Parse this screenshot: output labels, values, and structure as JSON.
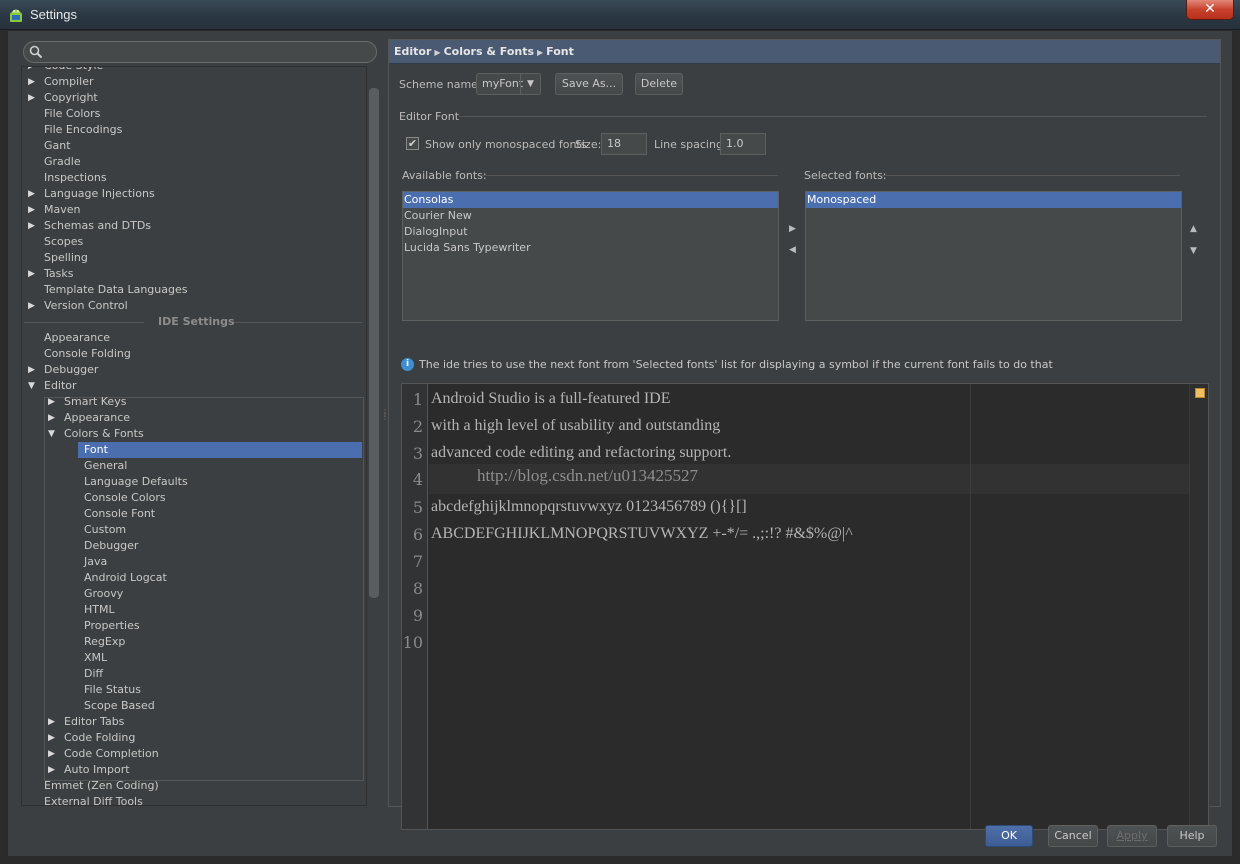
{
  "window": {
    "title": "Settings",
    "close_glyph": "✕"
  },
  "search": {
    "placeholder": "",
    "icon": "search-icon"
  },
  "tree": {
    "project_items": [
      {
        "label": "Code Style",
        "arrow": true
      },
      {
        "label": "Compiler",
        "arrow": true
      },
      {
        "label": "Copyright",
        "arrow": true
      },
      {
        "label": "File Colors",
        "arrow": false
      },
      {
        "label": "File Encodings",
        "arrow": false
      },
      {
        "label": "Gant",
        "arrow": false
      },
      {
        "label": "Gradle",
        "arrow": false
      },
      {
        "label": "Inspections",
        "arrow": false
      },
      {
        "label": "Language Injections",
        "arrow": true
      },
      {
        "label": "Maven",
        "arrow": true
      },
      {
        "label": "Schemas and DTDs",
        "arrow": true
      },
      {
        "label": "Scopes",
        "arrow": false
      },
      {
        "label": "Spelling",
        "arrow": false
      },
      {
        "label": "Tasks",
        "arrow": true
      },
      {
        "label": "Template Data Languages",
        "arrow": false
      },
      {
        "label": "Version Control",
        "arrow": true
      }
    ],
    "section_label": "IDE Settings",
    "ide_items": [
      {
        "label": "Appearance",
        "arrow": false
      },
      {
        "label": "Console Folding",
        "arrow": false
      },
      {
        "label": "Debugger",
        "arrow": true
      },
      {
        "label": "Editor",
        "arrow": "open"
      }
    ],
    "editor_children": [
      {
        "label": "Smart Keys",
        "arrow": true
      },
      {
        "label": "Appearance",
        "arrow": true
      },
      {
        "label": "Colors & Fonts",
        "arrow": "open"
      }
    ],
    "colors_fonts_children": [
      "Font",
      "General",
      "Language Defaults",
      "Console Colors",
      "Console Font",
      "Custom",
      "Debugger",
      "Java",
      "Android Logcat",
      "Groovy",
      "HTML",
      "Properties",
      "RegExp",
      "XML",
      "Diff",
      "File Status",
      "Scope Based"
    ],
    "selected": "Font",
    "editor_more": [
      {
        "label": "Editor Tabs",
        "arrow": true
      },
      {
        "label": "Code Folding",
        "arrow": true
      },
      {
        "label": "Code Completion",
        "arrow": true
      },
      {
        "label": "Auto Import",
        "arrow": true
      }
    ],
    "tail_items": [
      "Emmet (Zen Coding)",
      "External Diff Tools"
    ]
  },
  "breadcrumb": [
    "Editor",
    "Colors & Fonts",
    "Font"
  ],
  "scheme": {
    "label": "Scheme name:",
    "value": "myFont",
    "save_as": "Save As...",
    "delete": "Delete"
  },
  "editor_font": {
    "group_label": "Editor Font",
    "mono_label": "Show only monospaced fonts",
    "mono_checked": true,
    "size_label": "Size:",
    "size_value": "18",
    "spacing_label": "Line spacing:",
    "spacing_value": "1.0",
    "available_label": "Available fonts:",
    "available_fonts": [
      "Consolas",
      "Courier New",
      "DialogInput",
      "Lucida Sans Typewriter"
    ],
    "available_selected": "Consolas",
    "selected_label": "Selected fonts:",
    "selected_fonts": [
      "Monospaced"
    ],
    "info_text": "The ide tries to use the next font from 'Selected fonts' list for displaying a symbol if the current font fails to do that"
  },
  "preview": {
    "lines": [
      "Android Studio is a full-featured IDE",
      "with a high level of usability and outstanding",
      "advanced code editing and refactoring support.",
      "",
      "abcdefghijklmnopqrstuvwxyz 0123456789 (){}[]",
      "ABCDEFGHIJKLMNOPQRSTUVWXYZ +-*/= .,;:!? #&$%@|^",
      "",
      "",
      "",
      ""
    ],
    "line_numbers": [
      "1",
      "2",
      "3",
      "4",
      "5",
      "6",
      "7",
      "8",
      "9",
      "10"
    ],
    "watermark": "http://blog.csdn.net/u013425527"
  },
  "buttons": {
    "ok": "OK",
    "cancel": "Cancel",
    "apply": "Apply",
    "help": "Help"
  },
  "colors": {
    "accent": "#4b6eaf",
    "background": "#3c3f41",
    "editor_bg": "#2b2b2b"
  }
}
